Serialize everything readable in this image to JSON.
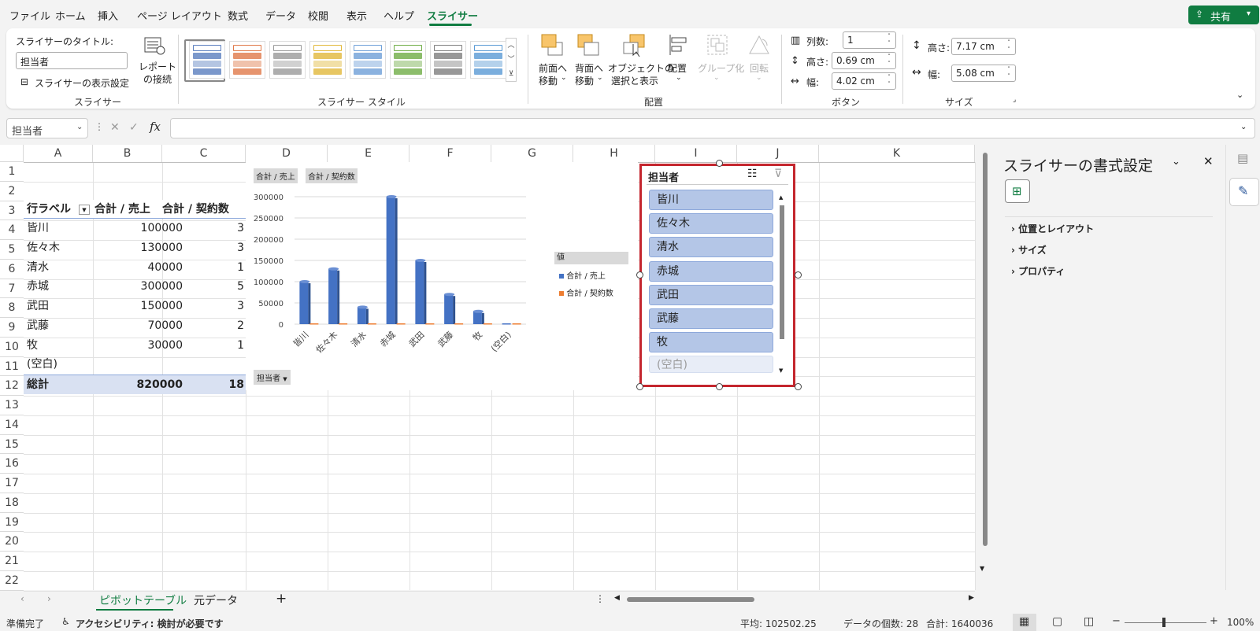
{
  "menu": {
    "items": [
      "ファイル",
      "ホーム",
      "挿入",
      "ページ レイアウト",
      "数式",
      "データ",
      "校閲",
      "表示",
      "ヘルプ",
      "スライサー"
    ],
    "active_index": 9,
    "share_label": "共有"
  },
  "ribbon": {
    "slicer_group": {
      "caption_label": "スライサーのタイトル:",
      "caption_value": "担当者",
      "settings_label": "スライサーの表示設定",
      "report_conn_line1": "レポート",
      "report_conn_line2": "の接続",
      "group_label": "スライサー"
    },
    "styles_group": {
      "group_label": "スライサー スタイル"
    },
    "arrange_group": {
      "bring_forward_line1": "前面へ",
      "bring_forward_line2": "移動",
      "send_backward_line1": "背面へ",
      "send_backward_line2": "移動",
      "selection_pane_line1": "オブジェクトの",
      "selection_pane_line2": "選択と表示",
      "align_label": "配置",
      "group_btn_label": "グループ化",
      "rotate_label": "回転",
      "group_label": "配置"
    },
    "buttons_group": {
      "columns_label": "列数:",
      "columns_value": "1",
      "height_label": "高さ:",
      "height_value": "0.69 cm",
      "width_label": "幅:",
      "width_value": "4.02 cm",
      "group_label": "ボタン"
    },
    "size_group": {
      "height_label": "高さ:",
      "height_value": "7.17 cm",
      "width_label": "幅:",
      "width_value": "5.08 cm",
      "group_label": "サイズ"
    }
  },
  "formula_bar": {
    "name_box": "担当者",
    "fx": "fx",
    "formula": ""
  },
  "columns": [
    "A",
    "B",
    "C",
    "D",
    "E",
    "F",
    "G",
    "H",
    "I",
    "J",
    "K"
  ],
  "rows": [
    "1",
    "2",
    "3",
    "4",
    "5",
    "6",
    "7",
    "8",
    "9",
    "10",
    "11",
    "12",
    "13",
    "14",
    "15",
    "16",
    "17",
    "18",
    "19",
    "20",
    "21",
    "22"
  ],
  "pivot": {
    "headers": [
      "行ラベル",
      "合計 / 売上",
      "合計 / 契約数"
    ],
    "rows": [
      {
        "label": "皆川",
        "sales": "100000",
        "count": "3"
      },
      {
        "label": "佐々木",
        "sales": "130000",
        "count": "3"
      },
      {
        "label": "清水",
        "sales": "40000",
        "count": "1"
      },
      {
        "label": "赤城",
        "sales": "300000",
        "count": "5"
      },
      {
        "label": "武田",
        "sales": "150000",
        "count": "3"
      },
      {
        "label": "武藤",
        "sales": "70000",
        "count": "2"
      },
      {
        "label": "牧",
        "sales": "30000",
        "count": "1"
      },
      {
        "label": "(空白)",
        "sales": "",
        "count": ""
      }
    ],
    "total": {
      "label": "総計",
      "sales": "820000",
      "count": "18"
    }
  },
  "chart_data": {
    "type": "bar",
    "field_buttons": [
      "合計 / 売上",
      "合計 / 契約数"
    ],
    "axis_field_button": "担当者",
    "categories": [
      "皆川",
      "佐々木",
      "清水",
      "赤城",
      "武田",
      "武藤",
      "牧",
      "(空白)"
    ],
    "series": [
      {
        "name": "合計 / 売上",
        "values": [
          100000,
          130000,
          40000,
          300000,
          150000,
          70000,
          30000,
          0
        ],
        "color": "#4472c4"
      },
      {
        "name": "合計 / 契約数",
        "values": [
          3,
          3,
          1,
          5,
          3,
          2,
          1,
          0
        ],
        "color": "#ed7d31"
      }
    ],
    "yticks": [
      "300000",
      "250000",
      "200000",
      "150000",
      "100000",
      "50000",
      "0"
    ],
    "ylim": [
      0,
      300000
    ],
    "legend_title": "値",
    "legend_position": "right",
    "grid": true
  },
  "slicer": {
    "title": "担当者",
    "items": [
      "皆川",
      "佐々木",
      "清水",
      "赤城",
      "武田",
      "武藤",
      "牧",
      "(空白)"
    ],
    "border_color": "#c4262e"
  },
  "pane": {
    "title": "スライサーの書式設定",
    "sections": [
      "位置とレイアウト",
      "サイズ",
      "プロパティ"
    ]
  },
  "sheets": {
    "tabs": [
      "ピボットテーブル",
      "元データ"
    ],
    "active_index": 0
  },
  "status": {
    "ready": "準備完了",
    "accessibility": "アクセシビリティ: 検討が必要です",
    "average": "平均: 102502.25",
    "count": "データの個数: 28",
    "sum": "合計: 1640036",
    "zoom": "100%"
  },
  "accent_color": "#107c41"
}
